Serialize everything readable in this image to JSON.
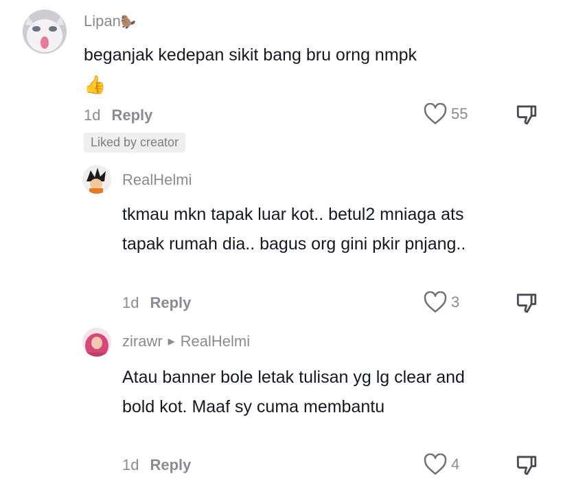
{
  "comments": [
    {
      "username": "Lipan",
      "username_emoji": "🦫",
      "text": "beganjak kedepan sikit bang bru orng nmpk",
      "emoji": "👍",
      "time": "1d",
      "reply_label": "Reply",
      "likes": "55",
      "badge": "Liked by creator"
    },
    {
      "username": "RealHelmi",
      "text": "tkmau mkn tapak luar kot.. betul2 mniaga ats tapak rumah dia.. bagus org gini pkir pnjang..",
      "time": "1d",
      "reply_label": "Reply",
      "likes": "3"
    },
    {
      "username": "zirawr",
      "reply_to": "RealHelmi",
      "text": "Atau banner bole letak tulisan yg lg clear and bold kot. Maaf sy cuma membantu",
      "time": "1d",
      "reply_label": "Reply",
      "likes": "4"
    }
  ],
  "icons": {
    "like": "heart-outline-icon",
    "dislike": "thumbs-down-icon",
    "reply_arrow": "triangle-right-icon"
  },
  "colors": {
    "text": "#161823",
    "muted": "#8a8b91",
    "badge_bg": "#efefef"
  }
}
